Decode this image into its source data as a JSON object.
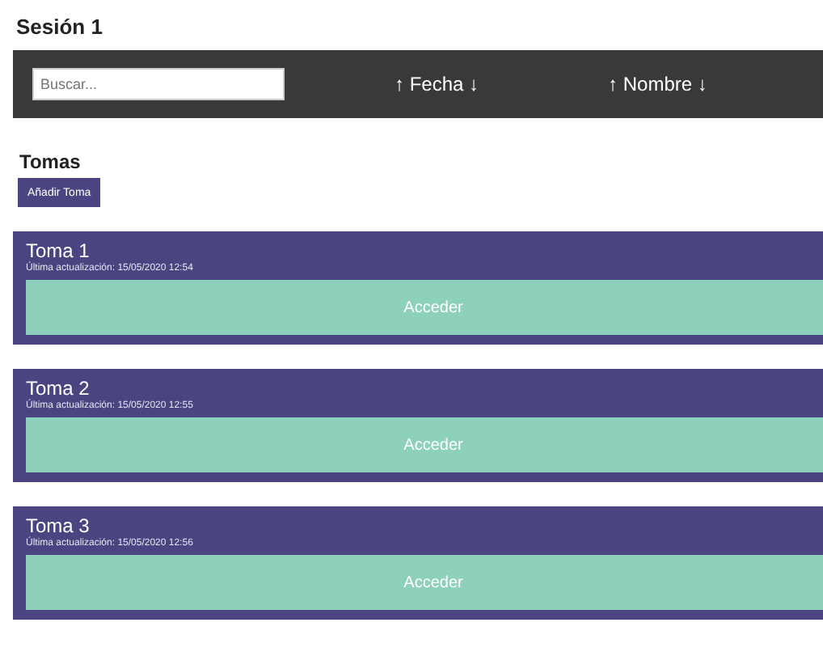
{
  "title": "Sesión 1",
  "toolbar": {
    "search": {
      "placeholder": "Buscar..."
    },
    "sort_buttons": [
      {
        "label": "↑ Fecha ↓"
      },
      {
        "label": "↑ Nombre ↓"
      }
    ]
  },
  "section": {
    "title": "Tomas",
    "add_button": "Añadir Toma"
  },
  "cards": [
    {
      "title": "Toma 1",
      "subtitle": "Última actualización: 15/05/2020 12:54",
      "action": "Acceder"
    },
    {
      "title": "Toma 2",
      "subtitle": "Última actualización: 15/05/2020 12:55",
      "action": "Acceder"
    },
    {
      "title": "Toma 3",
      "subtitle": "Última actualización: 15/05/2020 12:56",
      "action": "Acceder"
    }
  ]
}
